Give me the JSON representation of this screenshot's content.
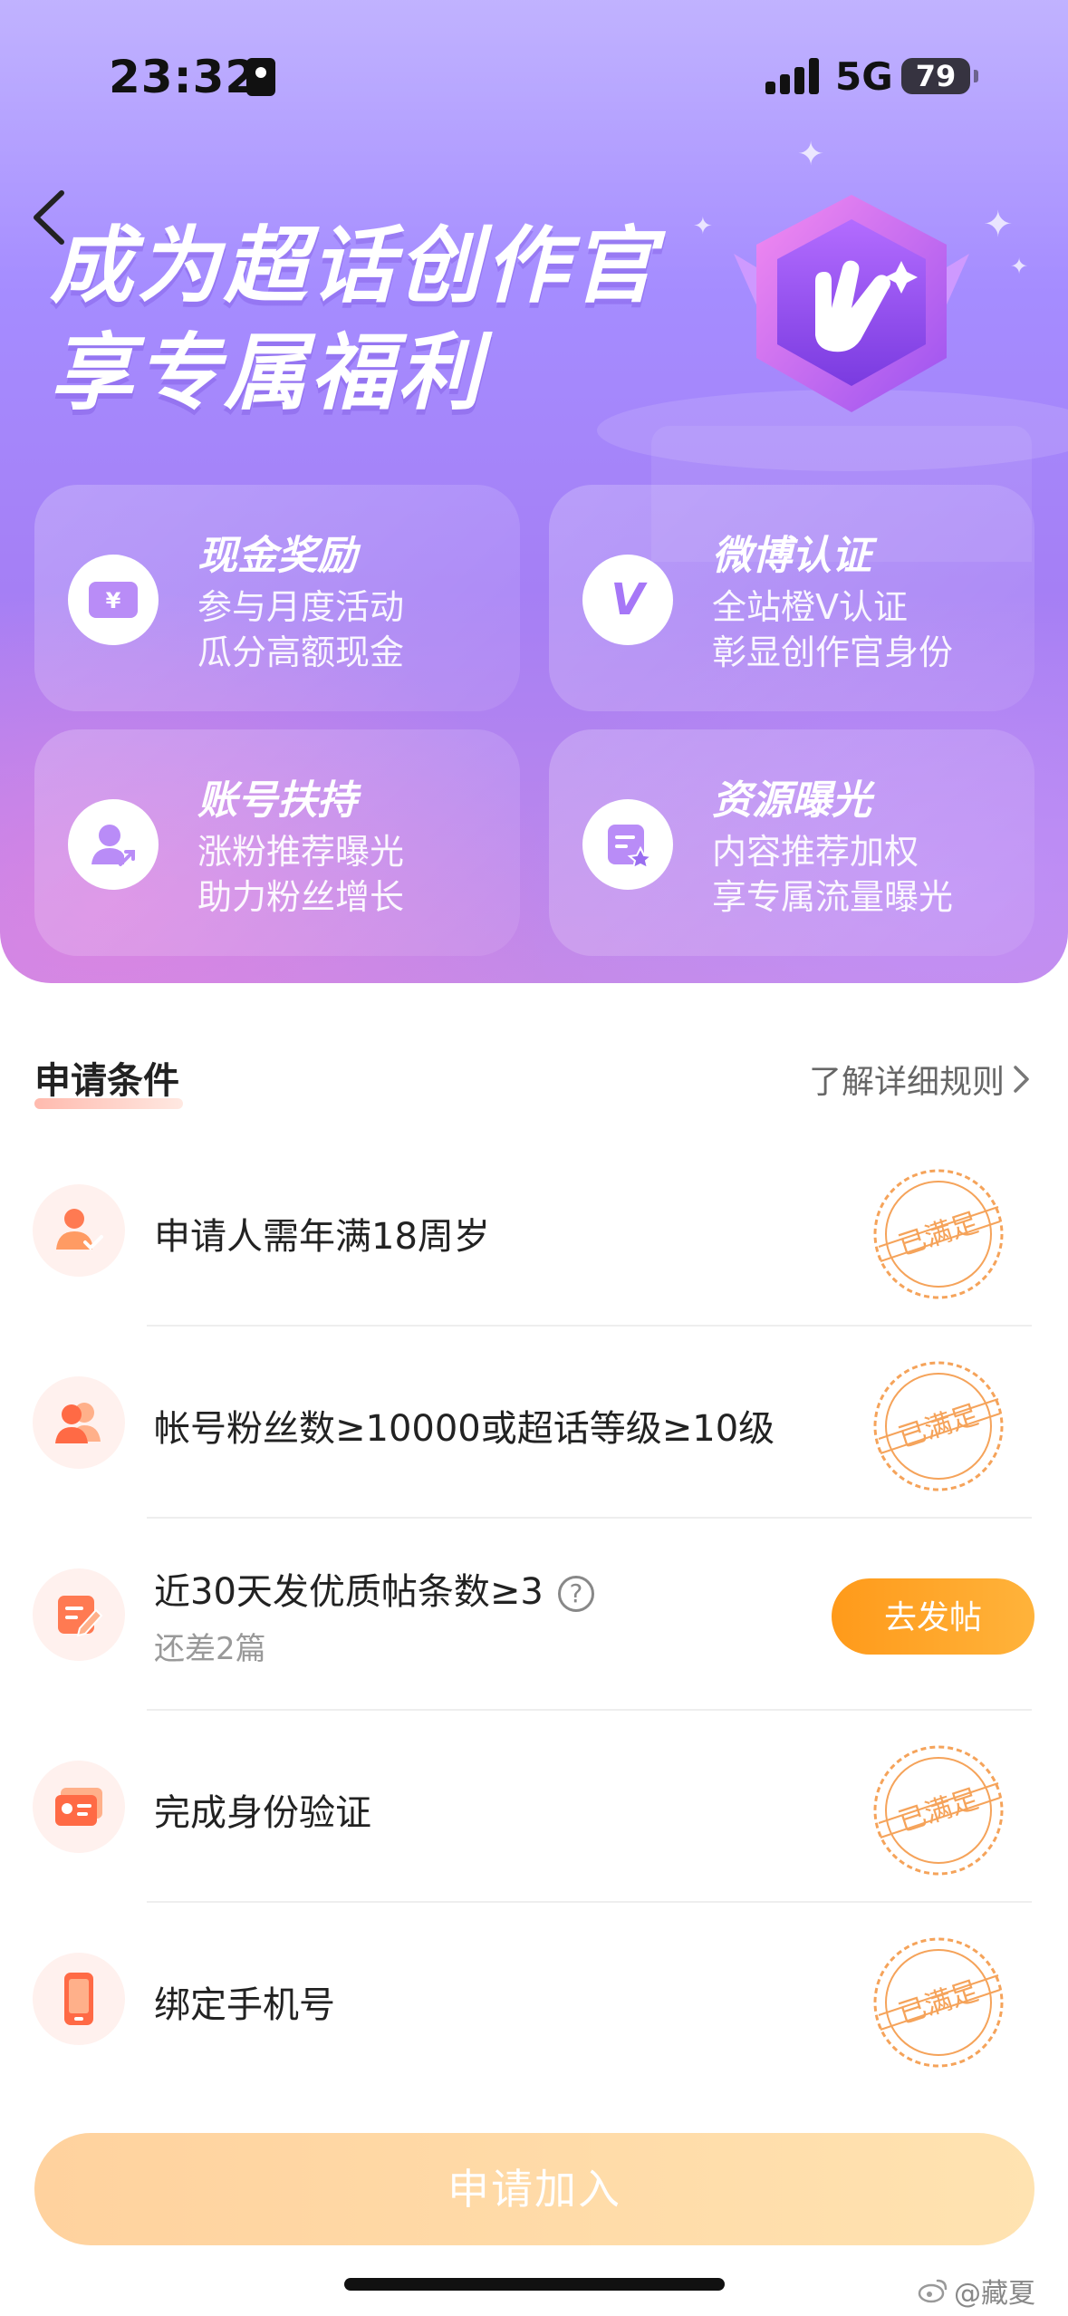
{
  "status_bar": {
    "time": "23:32",
    "network": "5G",
    "battery": "79"
  },
  "hero": {
    "headline_line1": "成为超话创作官",
    "headline_line2": "享专属福利",
    "benefits": [
      {
        "title": "现金奖励",
        "line1": "参与月度活动",
        "line2": "瓜分高额现金",
        "icon": "cash-ticket-icon"
      },
      {
        "title": "微博认证",
        "line1": "全站橙V认证",
        "line2": "彰显创作官身份",
        "icon": "v-verified-icon"
      },
      {
        "title": "账号扶持",
        "line1": "涨粉推荐曝光",
        "line2": "助力粉丝增长",
        "icon": "user-growth-icon"
      },
      {
        "title": "资源曝光",
        "line1": "内容推荐加权",
        "line2": "享专属流量曝光",
        "icon": "content-star-icon"
      }
    ]
  },
  "conditions": {
    "title": "申请条件",
    "rules_link": "了解详细规则",
    "stamp_text": "已满足",
    "items": [
      {
        "text": "申请人需年满18周岁",
        "status": "met",
        "icon": "adult-user-icon"
      },
      {
        "text": "帐号粉丝数≥10000或超话等级≥10级",
        "status": "met",
        "icon": "fans-icon"
      },
      {
        "text": "近30天发优质帖条数≥3",
        "sub": "还差2篇",
        "status": "pending",
        "action": "去发帖",
        "icon": "edit-post-icon",
        "help": "?"
      },
      {
        "text": "完成身份验证",
        "status": "met",
        "icon": "id-card-icon"
      },
      {
        "text": "绑定手机号",
        "status": "met",
        "icon": "phone-icon"
      }
    ]
  },
  "apply_button": "申请加入",
  "watermark": "@藏夏",
  "colors": {
    "accent_orange": "#ff9a1a",
    "stamp_orange": "#f5a35a",
    "hero_purple": "#a58cff"
  }
}
